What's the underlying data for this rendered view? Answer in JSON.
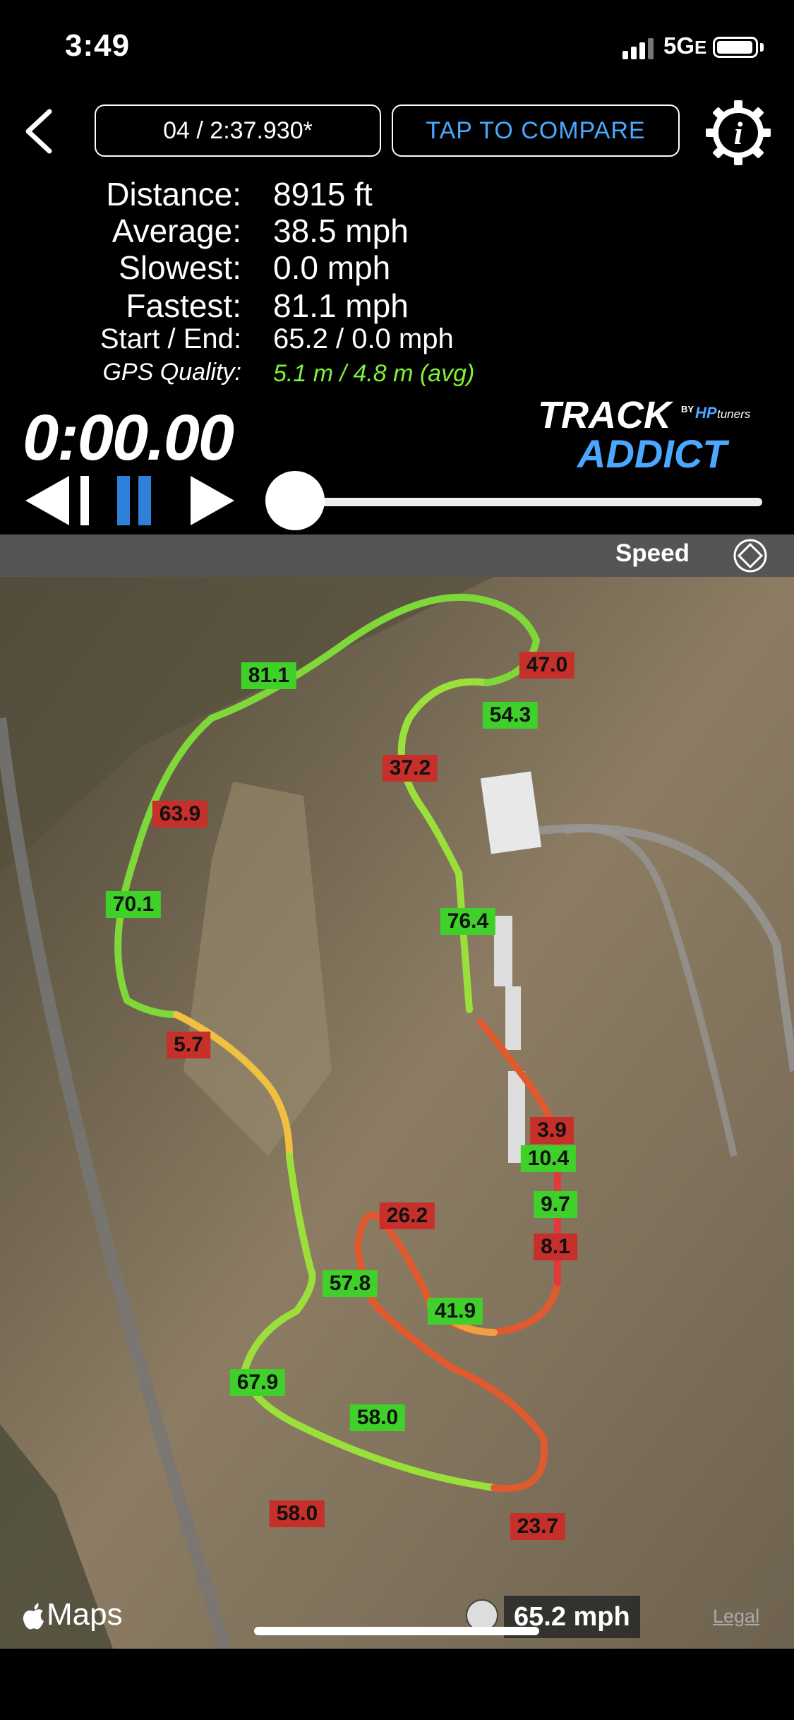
{
  "status_bar": {
    "time": "3:49",
    "network": "5G",
    "network_suffix": "E"
  },
  "header": {
    "back_label": "<",
    "lap_selector": "04 / 2:37.930*",
    "compare_button": "TAP TO COMPARE",
    "info_label": "i"
  },
  "stats": {
    "distance_label": "Distance:",
    "distance_value": "8915 ft",
    "average_label": "Average:",
    "average_value": "38.5 mph",
    "slowest_label": "Slowest:",
    "slowest_value": "0.0 mph",
    "fastest_label": "Fastest:",
    "fastest_value": "81.1 mph",
    "startend_label": "Start / End:",
    "startend_value": "65.2 / 0.0 mph",
    "gps_label": "GPS Quality:",
    "gps_value": "5.1 m / 4.8 m (avg)"
  },
  "timer": "0:00.00",
  "logo": {
    "line1": "TRACK",
    "line2": "ADDICT",
    "by": "BY",
    "brand": "HP",
    "brand_suffix": "tuners"
  },
  "playback": {
    "progress": 0.0
  },
  "metric_selector": {
    "label": "Speed"
  },
  "map": {
    "current_speed": "65.2 mph",
    "speed_tags": [
      {
        "value": "47.0",
        "color": "red"
      },
      {
        "value": "81.1",
        "color": "green"
      },
      {
        "value": "54.3",
        "color": "green"
      },
      {
        "value": "37.2",
        "color": "red"
      },
      {
        "value": "63.9",
        "color": "red"
      },
      {
        "value": "70.1",
        "color": "green"
      },
      {
        "value": "76.4",
        "color": "green"
      },
      {
        "value": "5.7",
        "color": "red"
      },
      {
        "value": "3.9",
        "color": "red"
      },
      {
        "value": "10.4",
        "color": "green"
      },
      {
        "value": "9.7",
        "color": "green"
      },
      {
        "value": "26.2",
        "color": "red"
      },
      {
        "value": "8.1",
        "color": "red"
      },
      {
        "value": "57.8",
        "color": "green"
      },
      {
        "value": "41.9",
        "color": "green"
      },
      {
        "value": "67.9",
        "color": "green"
      },
      {
        "value": "58.0",
        "color": "green"
      },
      {
        "value": "58.0",
        "color": "red"
      },
      {
        "value": "23.7",
        "color": "red"
      }
    ],
    "attribution": "Maps",
    "legal": "Legal"
  }
}
